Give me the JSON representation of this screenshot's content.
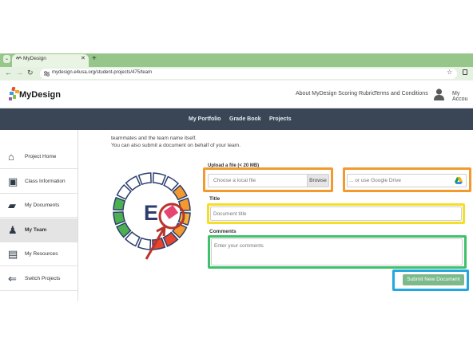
{
  "browser": {
    "tab_title": "MyDesign",
    "tab_close": "✕",
    "new_tab": "+",
    "tab_menu": "⌄",
    "back": "←",
    "forward": "→",
    "reload": "↻",
    "url": "mydesign.e4usa.org/student-projects/475/team",
    "star": "☆"
  },
  "header": {
    "logo": "MyDesign",
    "links": [
      "About MyDesign Scoring Rubric",
      "Terms and Conditions",
      "My Accou"
    ]
  },
  "nav": {
    "items": [
      "My Portfolio",
      "Grade Book",
      "Projects"
    ]
  },
  "sidebar": {
    "items": [
      {
        "label": "Project Home",
        "icon": "home-icon",
        "glyph": "⌂"
      },
      {
        "label": "Class Information",
        "icon": "classroom-icon",
        "glyph": "▣"
      },
      {
        "label": "My Documents",
        "icon": "folder-icon",
        "glyph": "▰"
      },
      {
        "label": "My Team",
        "icon": "team-icon",
        "glyph": "♟",
        "active": true
      },
      {
        "label": "My Resources",
        "icon": "book-icon",
        "glyph": "▤"
      },
      {
        "label": "Switch Projects",
        "icon": "arrow-left-icon",
        "glyph": "⇐"
      }
    ]
  },
  "content": {
    "intro_line2": "teammates and the team name itself.",
    "intro_line3": "You can also submit a document on behalf of your team.",
    "upload_label": "Upload a file (< 20 MB)",
    "file_placeholder": "Choose a local file",
    "browse_label": "Browse",
    "drive_placeholder": "... or use Google Drive",
    "title_label": "Title",
    "title_placeholder": "Document title",
    "comments_label": "Comments",
    "comments_placeholder": "Enter your comments",
    "submit_label": "Submit New Document",
    "wheel_letter": "E"
  },
  "colors": {
    "tabstrip": "#96c689",
    "navbar": "#3a4656",
    "highlight_orange": "#f29a2e",
    "highlight_yellow": "#f3df2a",
    "highlight_green": "#3fc06a",
    "highlight_blue": "#22a7e0",
    "annotation_red": "#b8342c",
    "submit": "#7cba8b"
  }
}
